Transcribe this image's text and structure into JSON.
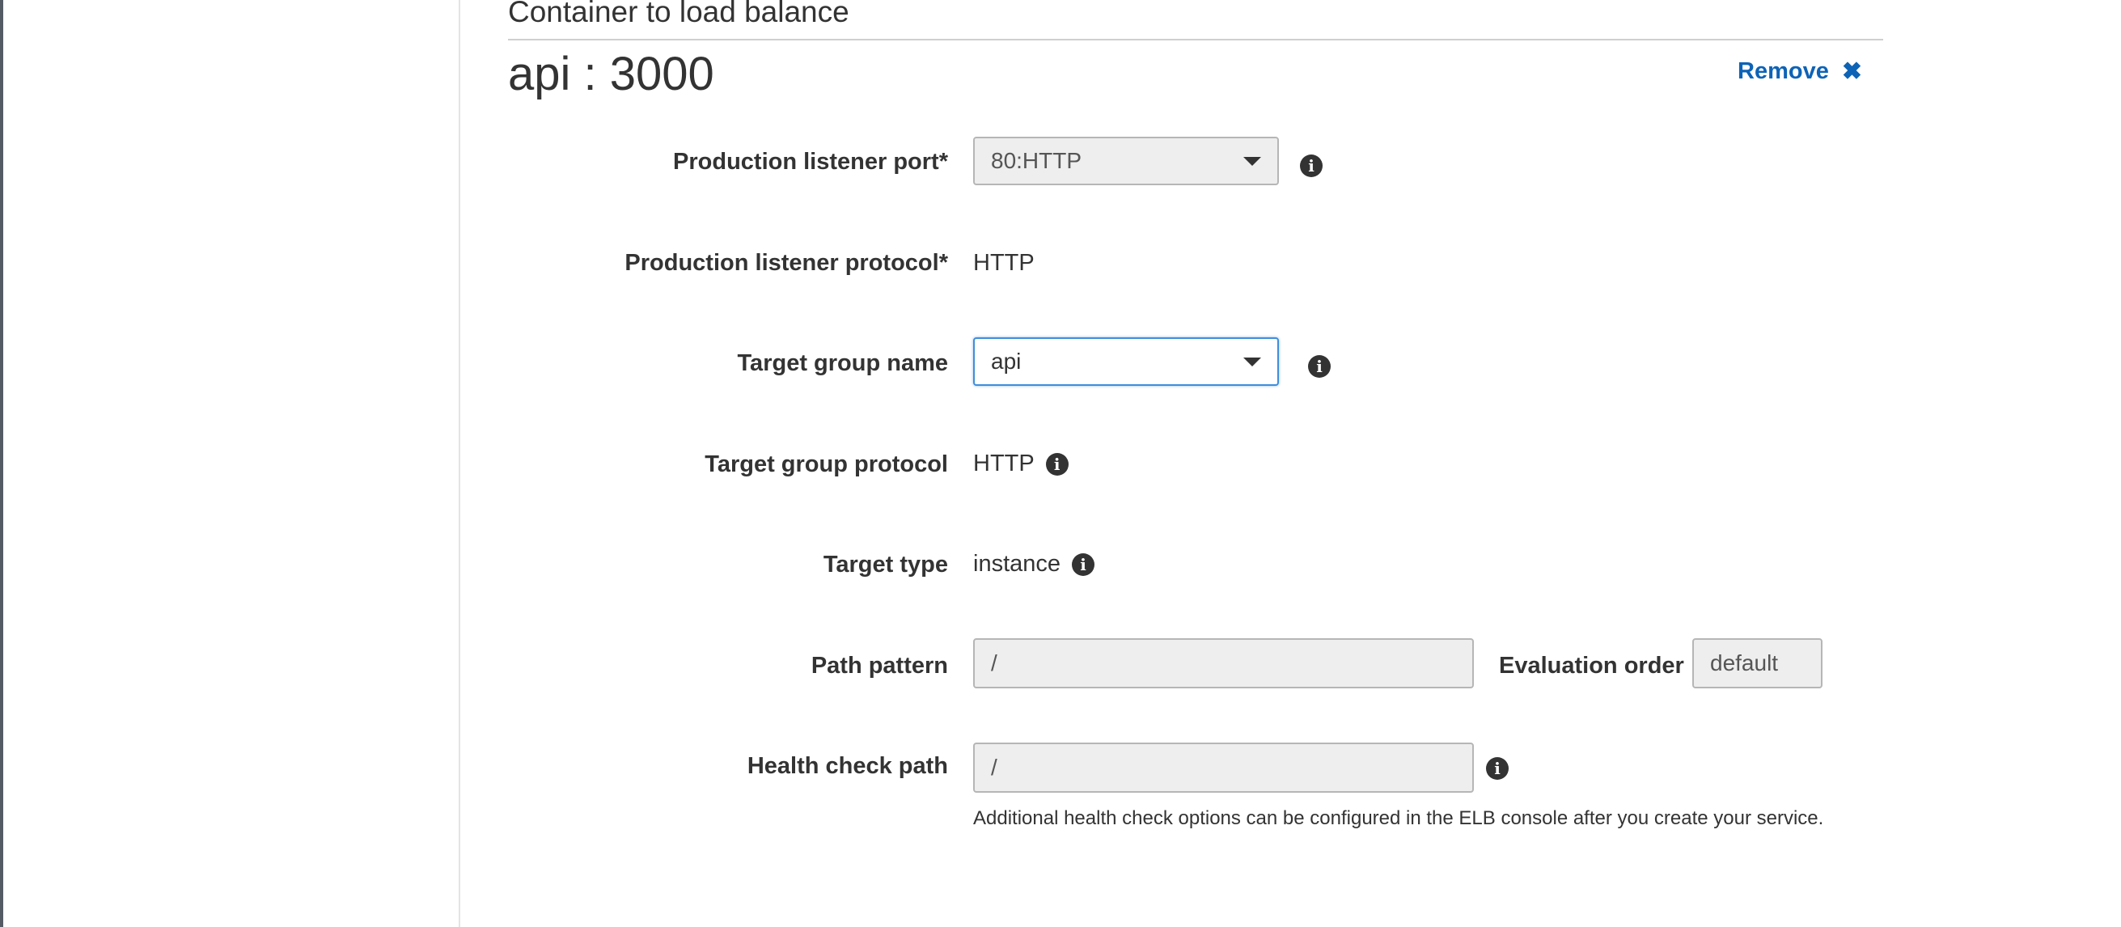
{
  "section": {
    "title": "Container to load balance"
  },
  "container": {
    "name": "api : 3000",
    "remove_label": "Remove"
  },
  "fields": {
    "production_listener_port": {
      "label": "Production listener port*",
      "value": "80:HTTP"
    },
    "production_listener_protocol": {
      "label": "Production listener protocol*",
      "value": "HTTP"
    },
    "target_group_name": {
      "label": "Target group name",
      "value": "api"
    },
    "target_group_protocol": {
      "label": "Target group protocol",
      "value": "HTTP"
    },
    "target_type": {
      "label": "Target type",
      "value": "instance"
    },
    "path_pattern": {
      "label": "Path pattern",
      "value": "/"
    },
    "evaluation_order": {
      "label": "Evaluation order",
      "value": "default"
    },
    "health_check_path": {
      "label": "Health check path",
      "value": "/",
      "help": "Additional health check options can be configured in the ELB console after you create your service."
    }
  },
  "icons": {
    "info": "info-icon",
    "remove": "close-icon",
    "dropdown": "chevron-down-icon"
  },
  "colors": {
    "link": "#0d63b6",
    "focus_border": "#3f8edc",
    "disabled_bg": "#eeeeee"
  }
}
